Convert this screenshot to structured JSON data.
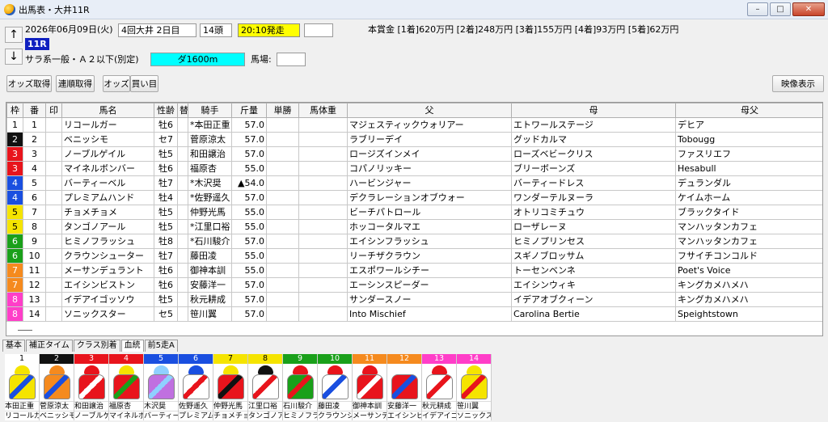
{
  "window": {
    "title": "出馬表・大井11R"
  },
  "header": {
    "date": "2026年06月09日(火)",
    "meeting": "4回大井 2日目",
    "heads": "14頭",
    "start_time": "20:10発走",
    "race_no": "11R",
    "condition": "サラ系一般・Ａ２以下(別定)",
    "course": "ダ1600m",
    "track_label": "馬場:",
    "prize": "本賞金 [1着]620万円 [2着]248万円 [3着]155万円 [4着]93万円 [5着]62万円"
  },
  "toolbar": {
    "odds_get": "オッズ取得",
    "serial_get": "連順取得",
    "odds": "オッズ",
    "buy": "買い目",
    "video": "映像表示",
    "up_arrow": "↑",
    "down_arrow": "↓"
  },
  "columns": [
    "枠",
    "番",
    "印",
    "馬名",
    "性齢",
    "替",
    "騎手",
    "斤量",
    "単勝",
    "馬体重",
    "父",
    "母",
    "母父"
  ],
  "frame_colors": {
    "1": "#ffffff",
    "2": "#111111",
    "3": "#e8141c",
    "4": "#1a4fe0",
    "5": "#f5e400",
    "6": "#1aa01a",
    "7": "#f58a1e",
    "8": "#ff3ec8"
  },
  "rows": [
    {
      "waku": "1",
      "num": "1",
      "horse": "リコールガー",
      "sexage": "牡6",
      "rider": "*本田正重",
      "weight": "57.0",
      "sire": "マジェスティックウォリアー",
      "dam": "エトワールステージ",
      "damsire": "デヒア"
    },
    {
      "waku": "2",
      "num": "2",
      "horse": "ベニッシモ",
      "sexage": "セ7",
      "rider": "菅原涼太",
      "weight": "57.0",
      "sire": "ラブリーデイ",
      "dam": "グッドカルマ",
      "damsire": "Tobougg"
    },
    {
      "waku": "3",
      "num": "3",
      "horse": "ノーブルゲイル",
      "sexage": "牡5",
      "rider": "和田譲治",
      "weight": "57.0",
      "sire": "ロージズインメイ",
      "dam": "ローズベビークリス",
      "damsire": "ファスリエフ"
    },
    {
      "waku": "3",
      "num": "4",
      "horse": "マイネルボンバー",
      "sexage": "牡6",
      "rider": "福原杏",
      "weight": "55.0",
      "sire": "コパノリッキー",
      "dam": "ブリーボーンズ",
      "damsire": "Hesabull"
    },
    {
      "waku": "4",
      "num": "5",
      "horse": "バーティーベル",
      "sexage": "牡7",
      "rider": "*木沢奨",
      "weight": "▲54.0",
      "sire": "ハービンジャー",
      "dam": "バーティードレス",
      "damsire": "デュランダル"
    },
    {
      "waku": "4",
      "num": "6",
      "horse": "プレミアムハンド",
      "sexage": "牡4",
      "rider": "*佐野遥久",
      "weight": "57.0",
      "sire": "デクラレーションオブウォー",
      "dam": "ワンダーテルヌーラ",
      "damsire": "ケイムホーム"
    },
    {
      "waku": "5",
      "num": "7",
      "horse": "チョメチョメ",
      "sexage": "牡5",
      "rider": "仲野光馬",
      "weight": "55.0",
      "sire": "ビーチパトロール",
      "dam": "オトリコミチュウ",
      "damsire": "ブラックタイド"
    },
    {
      "waku": "5",
      "num": "8",
      "horse": "タンゴノアール",
      "sexage": "牡5",
      "rider": "*江里口裕",
      "weight": "55.0",
      "sire": "ホッコータルマエ",
      "dam": "ローザレーヌ",
      "damsire": "マンハッタンカフェ"
    },
    {
      "waku": "6",
      "num": "9",
      "horse": "ヒミノフラッシュ",
      "sexage": "牡8",
      "rider": "*石川駿介",
      "weight": "57.0",
      "sire": "エイシンフラッシュ",
      "dam": "ヒミノプリンセス",
      "damsire": "マンハッタンカフェ"
    },
    {
      "waku": "6",
      "num": "10",
      "horse": "クラウンシューター",
      "sexage": "牡7",
      "rider": "藤田凌",
      "weight": "55.0",
      "sire": "リーチザクラウン",
      "dam": "スギノブロッサム",
      "damsire": "フサイチコンコルド"
    },
    {
      "waku": "7",
      "num": "11",
      "horse": "メーサンデュラント",
      "sexage": "牡6",
      "rider": "御神本訓",
      "weight": "55.0",
      "sire": "エスポワールシチー",
      "dam": "トーセンベンネ",
      "damsire": "Poet's Voice"
    },
    {
      "waku": "7",
      "num": "12",
      "horse": "エイシンビストン",
      "sexage": "牡6",
      "rider": "安藤洋一",
      "weight": "57.0",
      "sire": "エーシンスピーダー",
      "dam": "エイシンウィキ",
      "damsire": "キングカメハメハ"
    },
    {
      "waku": "8",
      "num": "13",
      "horse": "イデアイゴッソウ",
      "sexage": "牡5",
      "rider": "秋元耕成",
      "weight": "57.0",
      "sire": "サンダースノー",
      "dam": "イデアオブクィーン",
      "damsire": "キングカメハメハ"
    },
    {
      "waku": "8",
      "num": "14",
      "horse": "ソニックスター",
      "sexage": "セ5",
      "rider": "笹川翼",
      "weight": "57.0",
      "sire": "Into Mischief",
      "dam": "Carolina Bertie",
      "damsire": "Speightstown"
    }
  ],
  "tabs": [
    "基本",
    "補正タイム",
    "クラス別着",
    "血統",
    "前5走A"
  ],
  "silks": [
    {
      "num": "1",
      "jockey": "本田正重",
      "horse": "リコールガー",
      "cap": "#f5e400",
      "shirt": "#f5e400",
      "accent": "#1a4fe0"
    },
    {
      "num": "2",
      "jockey": "菅原涼太",
      "horse": "ベニッシモ",
      "cap": "#f58a1e",
      "shirt": "#f58a1e",
      "accent": "#1a4fe0"
    },
    {
      "num": "3",
      "jockey": "和田譲治",
      "horse": "ノーブルゲイル",
      "cap": "#e8141c",
      "shirt": "#e8141c",
      "accent": "#ffffff"
    },
    {
      "num": "4",
      "jockey": "福原杏",
      "horse": "マイネルボンバー",
      "cap": "#f5e400",
      "shirt": "#e8141c",
      "accent": "#1aa01a"
    },
    {
      "num": "5",
      "jockey": "木沢奨",
      "horse": "バーティーベル",
      "cap": "#8fd0ff",
      "shirt": "#c070e0",
      "accent": "#8fd0ff"
    },
    {
      "num": "6",
      "jockey": "佐野遥久",
      "horse": "プレミアムハンド",
      "cap": "#1a4fe0",
      "shirt": "#ffffff",
      "accent": "#e8141c"
    },
    {
      "num": "7",
      "jockey": "仲野光馬",
      "horse": "チョメチョメ",
      "cap": "#f5e400",
      "shirt": "#e8141c",
      "accent": "#111111"
    },
    {
      "num": "8",
      "jockey": "江里口裕",
      "horse": "タンゴノアール",
      "cap": "#111111",
      "shirt": "#ffffff",
      "accent": "#e8141c"
    },
    {
      "num": "9",
      "jockey": "石川駿介",
      "horse": "ヒミノフラッシュ",
      "cap": "#e8141c",
      "shirt": "#1aa01a",
      "accent": "#e8141c"
    },
    {
      "num": "10",
      "jockey": "藤田凌",
      "horse": "クラウンシューター",
      "cap": "#e8141c",
      "shirt": "#ffffff",
      "accent": "#1a4fe0"
    },
    {
      "num": "11",
      "jockey": "御神本訓",
      "horse": "メーサンデュラント",
      "cap": "#e8141c",
      "shirt": "#e8141c",
      "accent": "#ffffff"
    },
    {
      "num": "12",
      "jockey": "安藤洋一",
      "horse": "エイシンビストン",
      "cap": "#ffffff",
      "shirt": "#e8141c",
      "accent": "#1a4fe0"
    },
    {
      "num": "13",
      "jockey": "秋元耕成",
      "horse": "イデアイゴッソウ",
      "cap": "#e8141c",
      "shirt": "#ffffff",
      "accent": "#e8141c"
    },
    {
      "num": "14",
      "jockey": "笹川翼",
      "horse": "ソニックスター",
      "cap": "#f5e400",
      "shirt": "#f5e400",
      "accent": "#e8141c"
    }
  ]
}
